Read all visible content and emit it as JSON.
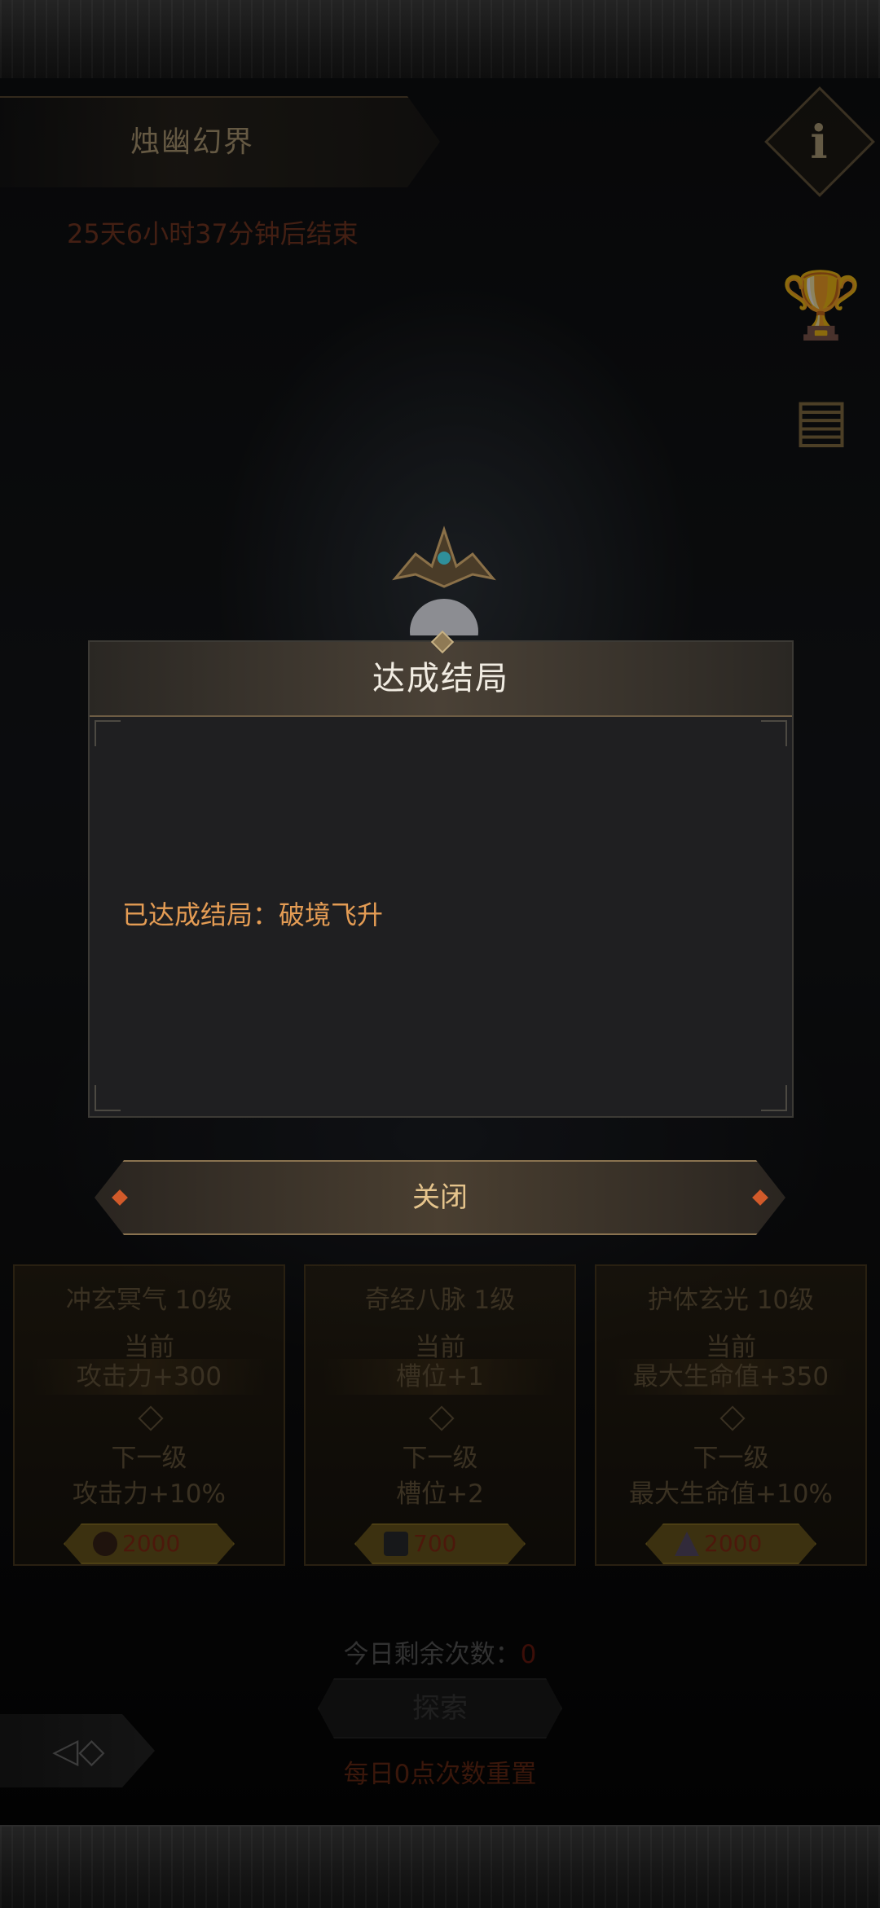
{
  "header": {
    "zone_title": "烛幽幻界",
    "timer": "25天6小时37分钟后结束"
  },
  "side_icons": [
    "info-icon",
    "trophy-icon",
    "scroll-icon"
  ],
  "modal": {
    "title": "达成结局",
    "message": "已达成结局：破境飞升",
    "close_label": "关闭"
  },
  "cards": [
    {
      "title": "冲玄冥气  10级",
      "current_label": "当前",
      "current_value": "攻击力+300",
      "next_label": "下一级",
      "next_value": "攻击力+10%",
      "cost_icon": "potion-icon",
      "cost": "2000"
    },
    {
      "title": "奇经八脉  1级",
      "current_label": "当前",
      "current_value": "槽位+1",
      "next_label": "下一级",
      "next_value": "槽位+2",
      "cost_icon": "chest-icon",
      "cost": "700"
    },
    {
      "title": "护体玄光  10级",
      "current_label": "当前",
      "current_value": "最大生命值+350",
      "next_label": "下一级",
      "next_value": "最大生命值+10%",
      "cost_icon": "crystal-icon",
      "cost": "2000"
    }
  ],
  "footer": {
    "remaining_label": "今日剩余次数：",
    "remaining_count": "0",
    "explore_label": "探索",
    "reset_note": "每日0点次数重置"
  },
  "colors": {
    "accent_gold": "#e5c48c",
    "message_orange": "#e49c54",
    "timer_red": "#7a3a24"
  }
}
